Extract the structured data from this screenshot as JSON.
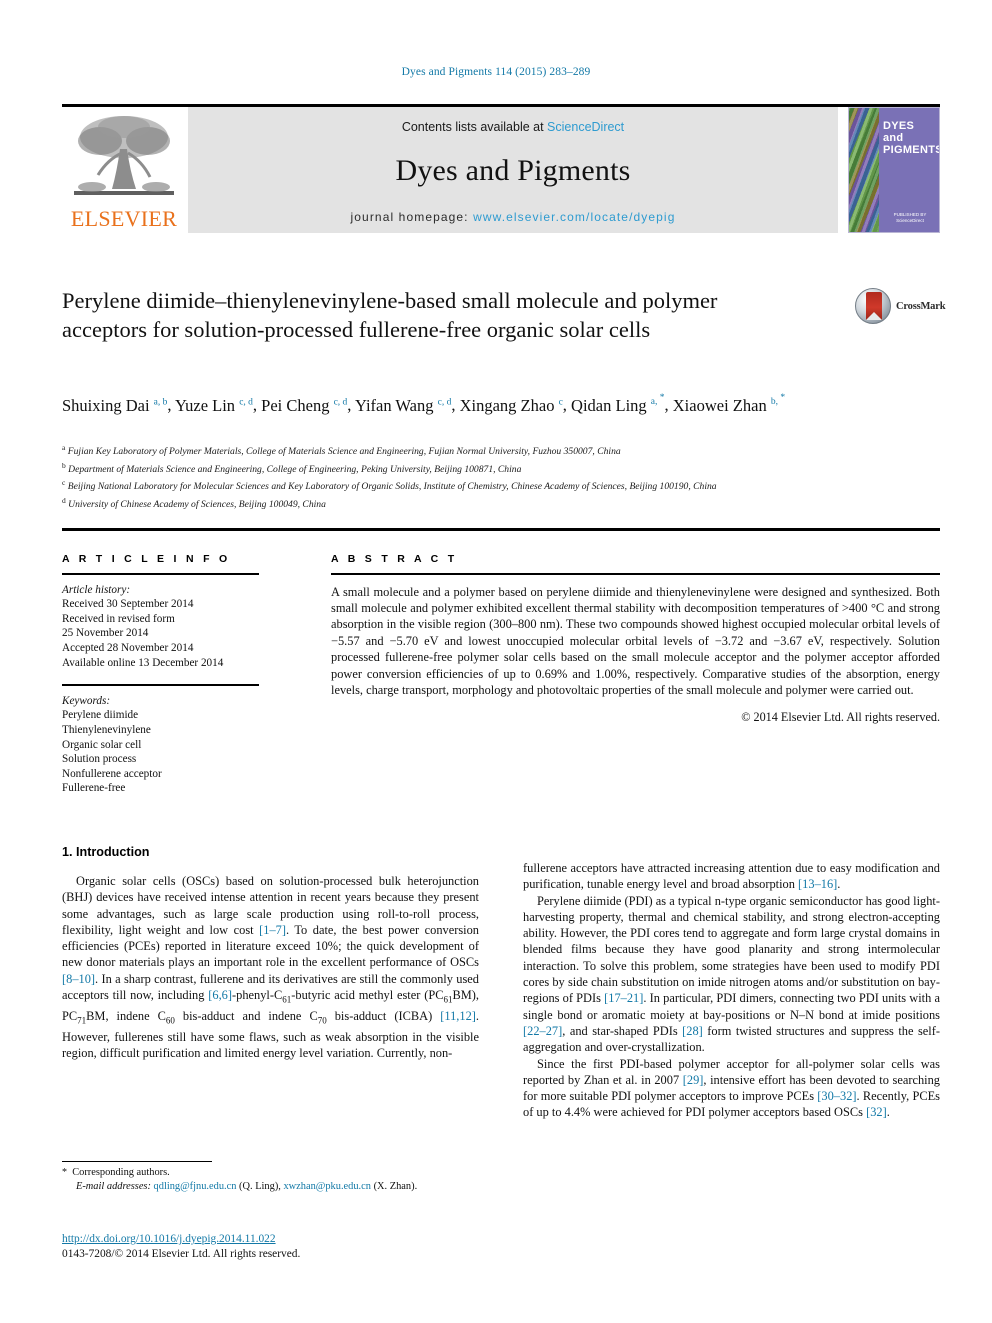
{
  "running_head": "Dyes and Pigments 114 (2015) 283–289",
  "header": {
    "publisher": "ELSEVIER",
    "contents_prefix": "Contents lists available at ",
    "contents_link": "ScienceDirect",
    "journal_name": "Dyes and Pigments",
    "homepage_prefix": "journal homepage: ",
    "homepage_url": "www.elsevier.com/locate/dyepig",
    "cover_title": "DYES and PIGMENTS",
    "cover_footer": "PUBLISHED BY ScienceDirect www.sciencedirect.com"
  },
  "article": {
    "title": "Perylene diimide–thienylenevinylene-based small molecule and polymer acceptors for solution-processed fullerene-free organic solar cells",
    "crossmark_label": "CrossMark",
    "authors": [
      {
        "name": "Shuixing Dai",
        "marks": "a, b"
      },
      {
        "name": "Yuze Lin",
        "marks": "c, d"
      },
      {
        "name": "Pei Cheng",
        "marks": "c, d"
      },
      {
        "name": "Yifan Wang",
        "marks": "c, d"
      },
      {
        "name": "Xingang Zhao",
        "marks": "c"
      },
      {
        "name": "Qidan Ling",
        "marks": "a, *"
      },
      {
        "name": "Xiaowei Zhan",
        "marks": "b, *"
      }
    ],
    "affiliations": [
      {
        "mark": "a",
        "text": "Fujian Key Laboratory of Polymer Materials, College of Materials Science and Engineering, Fujian Normal University, Fuzhou 350007, China"
      },
      {
        "mark": "b",
        "text": "Department of Materials Science and Engineering, College of Engineering, Peking University, Beijing 100871, China"
      },
      {
        "mark": "c",
        "text": "Beijing National Laboratory for Molecular Sciences and Key Laboratory of Organic Solids, Institute of Chemistry, Chinese Academy of Sciences, Beijing 100190, China"
      },
      {
        "mark": "d",
        "text": "University of Chinese Academy of Sciences, Beijing 100049, China"
      }
    ]
  },
  "article_info": {
    "label": "A R T I C L E   I N F O",
    "history_label": "Article history:",
    "history": [
      "Received 30 September 2014",
      "Received in revised form",
      "25 November 2014",
      "Accepted 28 November 2014",
      "Available online 13 December 2014"
    ],
    "keywords_label": "Keywords:",
    "keywords": [
      "Perylene diimide",
      "Thienylenevinylene",
      "Organic solar cell",
      "Solution process",
      "Nonfullerene acceptor",
      "Fullerene-free"
    ]
  },
  "abstract": {
    "label": "A B S T R A C T",
    "text": "A small molecule and a polymer based on perylene diimide and thienylenevinylene were designed and synthesized. Both small molecule and polymer exhibited excellent thermal stability with decomposition temperatures of >400 °C and strong absorption in the visible region (300–800 nm). These two compounds showed highest occupied molecular orbital levels of −5.57 and −5.70 eV and lowest unoccupied molecular orbital levels of −3.72 and −3.67 eV, respectively. Solution processed fullerene-free polymer solar cells based on the small molecule acceptor and the polymer acceptor afforded power conversion efficiencies of up to 0.69% and 1.00%, respectively. Comparative studies of the absorption, energy levels, charge transport, morphology and photovoltaic properties of the small molecule and polymer were carried out.",
    "copyright": "© 2014 Elsevier Ltd. All rights reserved."
  },
  "body": {
    "section_heading": "1.  Introduction",
    "left_paragraphs": [
      "Organic solar cells (OSCs) based on solution-processed bulk heterojunction (BHJ) devices have received intense attention in recent years because they present some advantages, such as large scale production using roll-to-roll process, flexibility, light weight and low cost [1–7]. To date, the best power conversion efficiencies (PCEs) reported in literature exceed 10%; the quick development of new donor materials plays an important role in the excellent performance of OSCs [8–10]. In a sharp contrast, fullerene and its derivatives are still the commonly used acceptors till now, including [6,6]-phenyl-C61-butyric acid methyl ester (PC61BM), PC71BM, indene C60 bis-adduct and indene C70 bis-adduct (ICBA) [11,12]. However, fullerenes still have some flaws, such as weak absorption in the visible region, difficult purification and limited energy level variation. Currently, non-"
    ],
    "right_paragraphs": [
      "fullerene acceptors have attracted increasing attention due to easy modification and purification, tunable energy level and broad absorption [13–16].",
      "Perylene diimide (PDI) as a typical n-type organic semiconductor has good light-harvesting property, thermal and chemical stability, and strong electron-accepting ability. However, the PDI cores tend to aggregate and form large crystal domains in blended films because they have good planarity and strong intermolecular interaction. To solve this problem, some strategies have been used to modify PDI cores by side chain substitution on imide nitrogen atoms and/or substitution on bay-regions of PDIs [17–21]. In particular, PDI dimers, connecting two PDI units with a single bond or aromatic moiety at bay-positions or N–N bond at imide positions [22–27], and star-shaped PDIs [28] form twisted structures and suppress the self-aggregation and over-crystallization.",
      "Since the first PDI-based polymer acceptor for all-polymer solar cells was reported by Zhan et al. in 2007 [29], intensive effort has been devoted to searching for more suitable PDI polymer acceptors to improve PCEs [30–32]. Recently, PCEs of up to 4.4% were achieved for PDI polymer acceptors based OSCs [32]."
    ]
  },
  "footnote": {
    "corresponding": "Corresponding authors.",
    "email_label": "E-mail addresses:",
    "email1": "qdling@fjnu.edu.cn",
    "email1_owner": "(Q. Ling)",
    "email2": "xwzhan@pku.edu.cn",
    "email2_owner": "(X. Zhan)"
  },
  "footer": {
    "doi": "http://dx.doi.org/10.1016/j.dyepig.2014.11.022",
    "issn": "0143-7208/© 2014 Elsevier Ltd. All rights reserved."
  },
  "colors": {
    "link": "#1379a7",
    "sciencedirect": "#2e9bd0",
    "elsevier_orange": "#E9711C",
    "cover_purple": "#7a71b6",
    "header_band": "#e3e3e3"
  }
}
